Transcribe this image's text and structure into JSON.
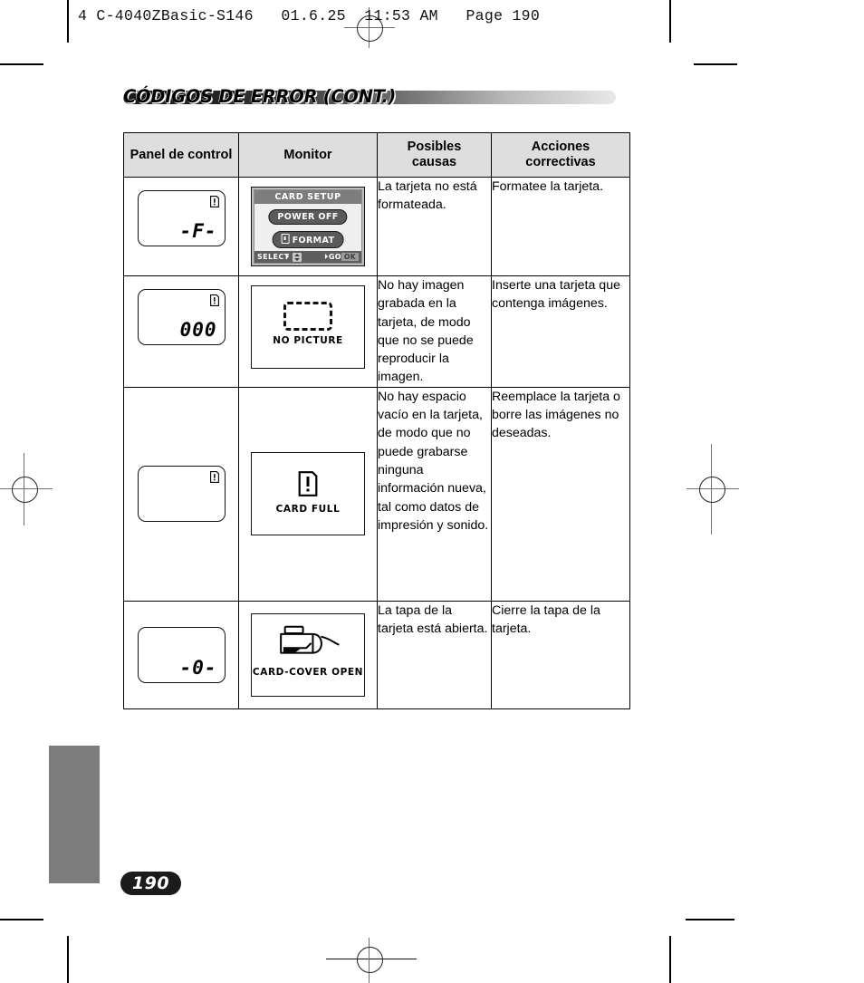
{
  "printer_slug": "4 C-4040ZBasic-S146   01.6.25  11:53 AM   Page 190",
  "page_title": "CÓDIGOS DE ERROR (CONT.)",
  "page_number": "190",
  "colors": {
    "title_bar_dark": "#1a1a1a",
    "title_bar_light": "#e8e8e8",
    "header_fill": "#dedede",
    "gray_block": "#7c7c7c",
    "page_badge": "#1b1b1b",
    "rule": "#000000"
  },
  "table": {
    "headers": [
      "Panel de control",
      "Monitor",
      "Posibles causas",
      "Acciones correctivas"
    ],
    "headers_lines": [
      [
        "Panel de control"
      ],
      [
        "Monitor"
      ],
      [
        "Posibles",
        "causas"
      ],
      [
        "Acciones",
        "correctivas"
      ]
    ],
    "rows": [
      {
        "panel": {
          "segment_text": "-F-",
          "card_icon": "card-error-icon"
        },
        "monitor": {
          "type": "card-setup-screen",
          "title": "CARD SETUP",
          "option_1": "POWER OFF",
          "option_2": "FORMAT",
          "foot_select": "SELECT",
          "foot_go": "GO",
          "foot_ok": "OK"
        },
        "cause": "La tarjeta no está formateada.",
        "action": "Formatee la tarjeta."
      },
      {
        "panel": {
          "segment_text": "000",
          "card_icon": "card-error-icon"
        },
        "monitor": {
          "type": "no-picture-screen",
          "label": "NO  PICTURE"
        },
        "cause": "No hay imagen grabada en la tarjeta, de modo que no se puede reproducir la imagen.",
        "action": "Inserte una tarjeta que contenga imágenes."
      },
      {
        "panel": {
          "segment_text": "",
          "card_icon": "card-error-icon"
        },
        "monitor": {
          "type": "card-full-screen",
          "label": "CARD  FULL"
        },
        "cause": "No hay espacio vacío en la tarjeta, de modo que no puede grabarse ninguna información nueva, tal como datos de impresión y sonido.",
        "action": "Reemplace la tarjeta o borre las imágenes no deseadas."
      },
      {
        "panel": {
          "segment_text": "-0-",
          "card_icon": ""
        },
        "monitor": {
          "type": "card-cover-open-screen",
          "label": "CARD-COVER OPEN"
        },
        "cause": "La tapa de la tarjeta está abierta.",
        "action": "Cierre la tapa de la tarjeta."
      }
    ]
  }
}
